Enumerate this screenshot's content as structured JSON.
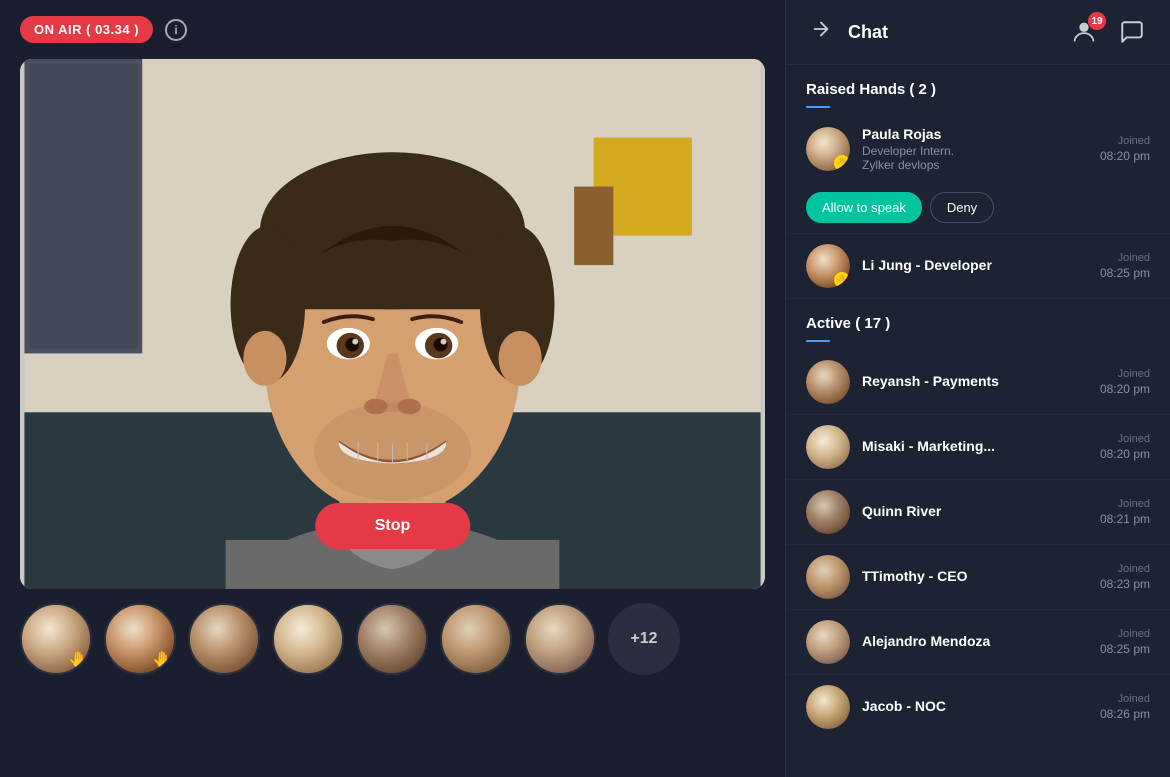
{
  "header": {
    "on_air_label": "ON AIR ( 03.34 )",
    "info_icon": "i"
  },
  "video": {
    "stop_button_label": "Stop"
  },
  "participants_strip": [
    {
      "id": 1,
      "has_hand": true,
      "av_class": "av-1"
    },
    {
      "id": 2,
      "has_hand": true,
      "av_class": "av-2"
    },
    {
      "id": 3,
      "has_hand": false,
      "av_class": "av-3"
    },
    {
      "id": 4,
      "has_hand": false,
      "av_class": "av-4"
    },
    {
      "id": 5,
      "has_hand": false,
      "av_class": "av-5"
    },
    {
      "id": 6,
      "has_hand": false,
      "av_class": "av-6"
    },
    {
      "id": 7,
      "has_hand": false,
      "av_class": "av-7"
    }
  ],
  "more_count": "+12",
  "chat": {
    "back_arrow": "→",
    "title": "Chat",
    "notification_count": "19"
  },
  "raised_hands": {
    "section_title": "Raised Hands ( 2 )",
    "members": [
      {
        "name": "Paula Rojas",
        "subtitle1": "Developer Intern.",
        "subtitle2": "Zylker devlops",
        "joined_label": "Joined",
        "joined_time": "08:20 pm",
        "av_class": "av-1",
        "allow_label": "Allow to speak",
        "deny_label": "Deny"
      },
      {
        "name": "Li Jung - Developer",
        "subtitle1": "",
        "subtitle2": "",
        "joined_label": "Joined",
        "joined_time": "08:25 pm",
        "av_class": "av-2"
      }
    ]
  },
  "active": {
    "section_title": "Active  ( 17 )",
    "members": [
      {
        "name": "Reyansh - Payments",
        "joined_label": "Joined",
        "joined_time": "08:20 pm",
        "av_class": "av-3"
      },
      {
        "name": "Misaki - Marketing...",
        "joined_label": "Joined",
        "joined_time": "08:20 pm",
        "av_class": "av-4"
      },
      {
        "name": "Quinn River",
        "joined_label": "Joined",
        "joined_time": "08:21 pm",
        "av_class": "av-5"
      },
      {
        "name": "TTimothy - CEO",
        "joined_label": "Joined",
        "joined_time": "08:23 pm",
        "av_class": "av-6"
      },
      {
        "name": "Alejandro Mendoza",
        "joined_label": "Joined",
        "joined_time": "08:25 pm",
        "av_class": "av-7"
      },
      {
        "name": "Jacob - NOC",
        "joined_label": "Joined",
        "joined_time": "08:26 pm",
        "av_class": "av-8"
      }
    ]
  }
}
